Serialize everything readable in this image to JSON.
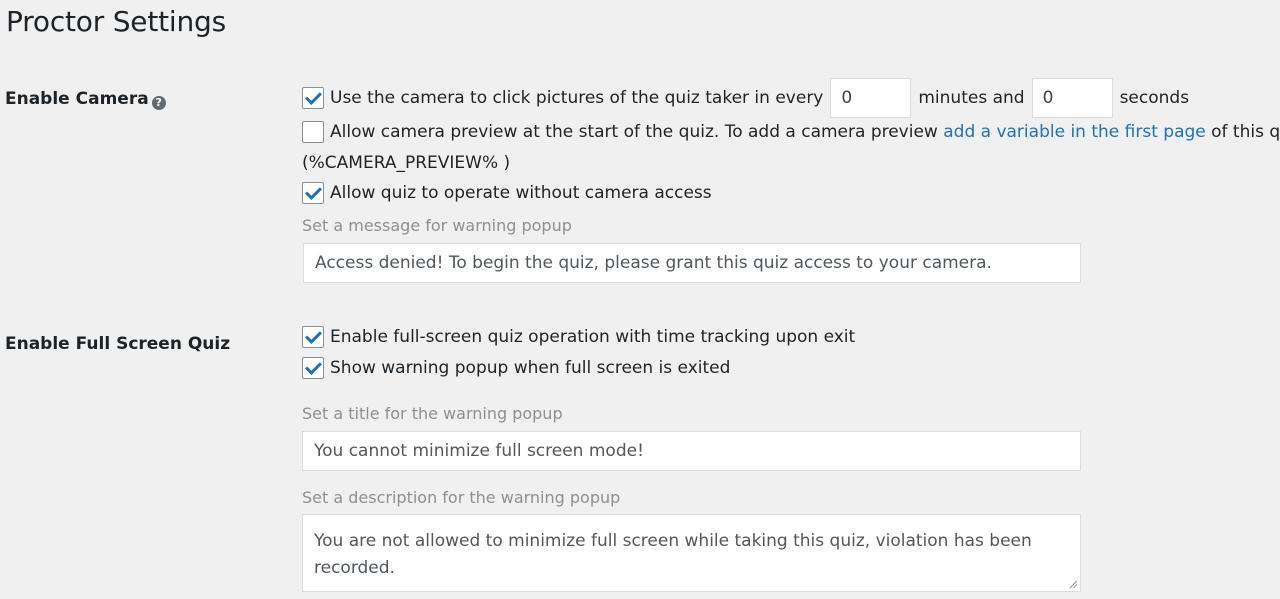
{
  "page": {
    "title": "Proctor Settings"
  },
  "camera": {
    "label": "Enable Camera",
    "help_icon": "question-mark-icon",
    "capture_prefix": "Use the camera to click pictures of the quiz taker in every",
    "minutes_value": "0",
    "minutes_suffix": "minutes and",
    "seconds_value": "0",
    "seconds_suffix": "seconds",
    "capture_checked": true,
    "preview_text": "Allow camera preview at the start of the quiz. To add a camera preview",
    "preview_link": "add a variable in the first page",
    "preview_suffix": "of this quiz",
    "preview_variable": "(%CAMERA_PREVIEW% )",
    "preview_checked": false,
    "no_access_label": "Allow quiz to operate without camera access",
    "no_access_checked": true,
    "warning_message_label": "Set a message for warning popup",
    "warning_message_value": "Access denied! To begin the quiz, please grant this quiz access to your camera."
  },
  "fullscreen": {
    "label": "Enable Full Screen Quiz",
    "tracking_label": "Enable full-screen quiz operation with time tracking upon exit",
    "tracking_checked": true,
    "warning_label": "Show warning popup when full screen is exited",
    "warning_checked": true,
    "title_label": "Set a title for the warning popup",
    "title_value": "You cannot minimize full screen mode!",
    "description_label": "Set a description for the warning popup",
    "description_value": "You are not allowed to minimize full screen while taking this quiz, violation has been recorded."
  },
  "colors": {
    "accent": "#2271b1",
    "background": "#f0f0f1"
  }
}
